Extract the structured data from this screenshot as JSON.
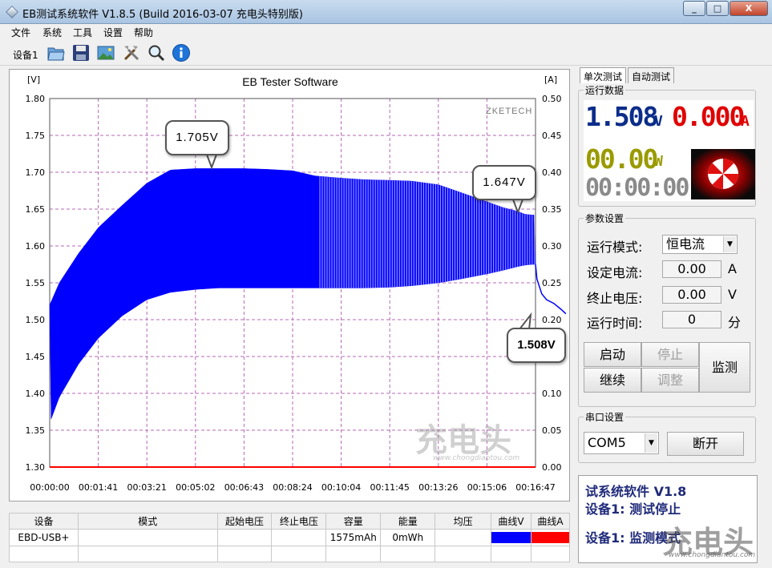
{
  "window": {
    "title": "EB测试系统软件 V1.8.5 (Build 2016-03-07 充电头特别版)",
    "controls": [
      "_",
      "□",
      "X"
    ]
  },
  "menu": [
    "文件",
    "系统",
    "工具",
    "设置",
    "帮助"
  ],
  "toolbar": {
    "device_label": "设备1",
    "tools": [
      {
        "icon": "folder-open-icon"
      },
      {
        "icon": "save-icon"
      },
      {
        "icon": "image-icon"
      },
      {
        "icon": "tools-icon"
      },
      {
        "icon": "search-icon"
      },
      {
        "icon": "info-icon"
      }
    ]
  },
  "chart": {
    "title": "EB Tester Software",
    "left_unit": "[V]",
    "right_unit": "[A]",
    "brand": "ZKETECH",
    "watermark": "充电头",
    "watermark_url": "www.chongdiantou.com",
    "callouts": [
      "1.705V",
      "1.647V",
      "1.508V"
    ]
  },
  "chart_data": {
    "type": "line",
    "title": "EB Tester Software",
    "xlabel": "",
    "ylabel": "[V]",
    "y2label": "[A]",
    "ylim": [
      1.3,
      1.8
    ],
    "y2lim": [
      0.0,
      0.5
    ],
    "yticks": [
      "1.80",
      "1.75",
      "1.70",
      "1.65",
      "1.60",
      "1.55",
      "1.50",
      "1.45",
      "1.40",
      "1.35",
      "1.30"
    ],
    "y2ticks": [
      "0.50",
      "0.45",
      "0.40",
      "0.35",
      "0.30",
      "0.25",
      "0.20",
      "0.15",
      "0.10",
      "0.05",
      "0.00"
    ],
    "xticks": [
      "00:00:00",
      "00:01:41",
      "00:03:21",
      "00:05:02",
      "00:06:43",
      "00:08:24",
      "00:10:04",
      "00:11:45",
      "00:13:26",
      "00:15:06",
      "00:16:47"
    ],
    "grid": true,
    "series": [
      {
        "color": "#0000ff",
        "style": "oscillating band",
        "x": [
          0,
          20,
          60,
          101,
          150,
          201,
          250,
          302,
          350,
          403,
          450,
          504,
          550,
          604,
          650,
          705,
          750,
          806,
          850,
          906,
          940,
          970,
          985,
          1000,
          1007
        ],
        "upper": [
          1.52,
          1.55,
          1.59,
          1.625,
          1.655,
          1.685,
          1.703,
          1.705,
          1.705,
          1.705,
          1.704,
          1.702,
          1.695,
          1.692,
          1.69,
          1.689,
          1.688,
          1.683,
          1.673,
          1.66,
          1.652,
          1.647,
          1.643,
          1.642,
          1.642
        ],
        "lower": [
          1.36,
          1.395,
          1.44,
          1.475,
          1.505,
          1.527,
          1.537,
          1.541,
          1.543,
          1.543,
          1.543,
          1.543,
          1.543,
          1.543,
          1.543,
          1.544,
          1.546,
          1.55,
          1.555,
          1.562,
          1.567,
          1.572,
          1.574,
          1.575,
          1.575
        ]
      },
      {
        "color": "#0000ff",
        "style": "line",
        "x": [
          1007,
          1010,
          1015,
          1020,
          1030,
          1045,
          1060,
          1070
        ],
        "values": [
          1.575,
          1.555,
          1.545,
          1.535,
          1.527,
          1.522,
          1.514,
          1.508
        ]
      },
      {
        "color": "#ff0000",
        "style": "line",
        "axis": "right",
        "x": [
          0,
          1007
        ],
        "values": [
          0.0,
          0.0
        ]
      }
    ]
  },
  "table": {
    "headers": [
      "设备",
      "模式",
      "起始电压",
      "终止电压",
      "容量",
      "能量",
      "均压",
      "曲线V",
      "曲线A"
    ],
    "row": [
      "EBD-USB+",
      "",
      "",
      "",
      "1575mAh",
      "0mWh",
      ""
    ],
    "curve_colors": [
      "#0000ff",
      "#ff0000"
    ]
  },
  "right": {
    "tabs": [
      "单次测试",
      "自动测试"
    ],
    "run_data": {
      "label": "运行数据",
      "voltage": "1.508",
      "voltage_unit": "V",
      "current": "0.000",
      "current_unit": "A",
      "power": "00.00",
      "power_unit": "W",
      "time": "00:00:00",
      "colors": {
        "voltage": "#0b2d8a",
        "current": "#e00000",
        "power": "#9a9a00",
        "time": "#8a8a8a"
      }
    },
    "params": {
      "label": "参数设置",
      "mode_label": "运行模式:",
      "mode_value": "恒电流",
      "current_label": "设定电流:",
      "current_value": "0.00",
      "current_unit": "A",
      "voltage_label": "终止电压:",
      "voltage_value": "0.00",
      "voltage_unit": "V",
      "time_label": "运行时间:",
      "time_value": "0",
      "time_unit": "分"
    },
    "buttons": {
      "start": "启动",
      "stop": "停止",
      "continue": "继续",
      "adjust": "调整",
      "monitor": "监测"
    },
    "serial": {
      "label": "串口设置",
      "port": "COM5",
      "disconnect": "断开"
    },
    "status": [
      "试系统软件 V1.8",
      "设备1: 测试停止",
      "设备1: 监测模式"
    ]
  }
}
